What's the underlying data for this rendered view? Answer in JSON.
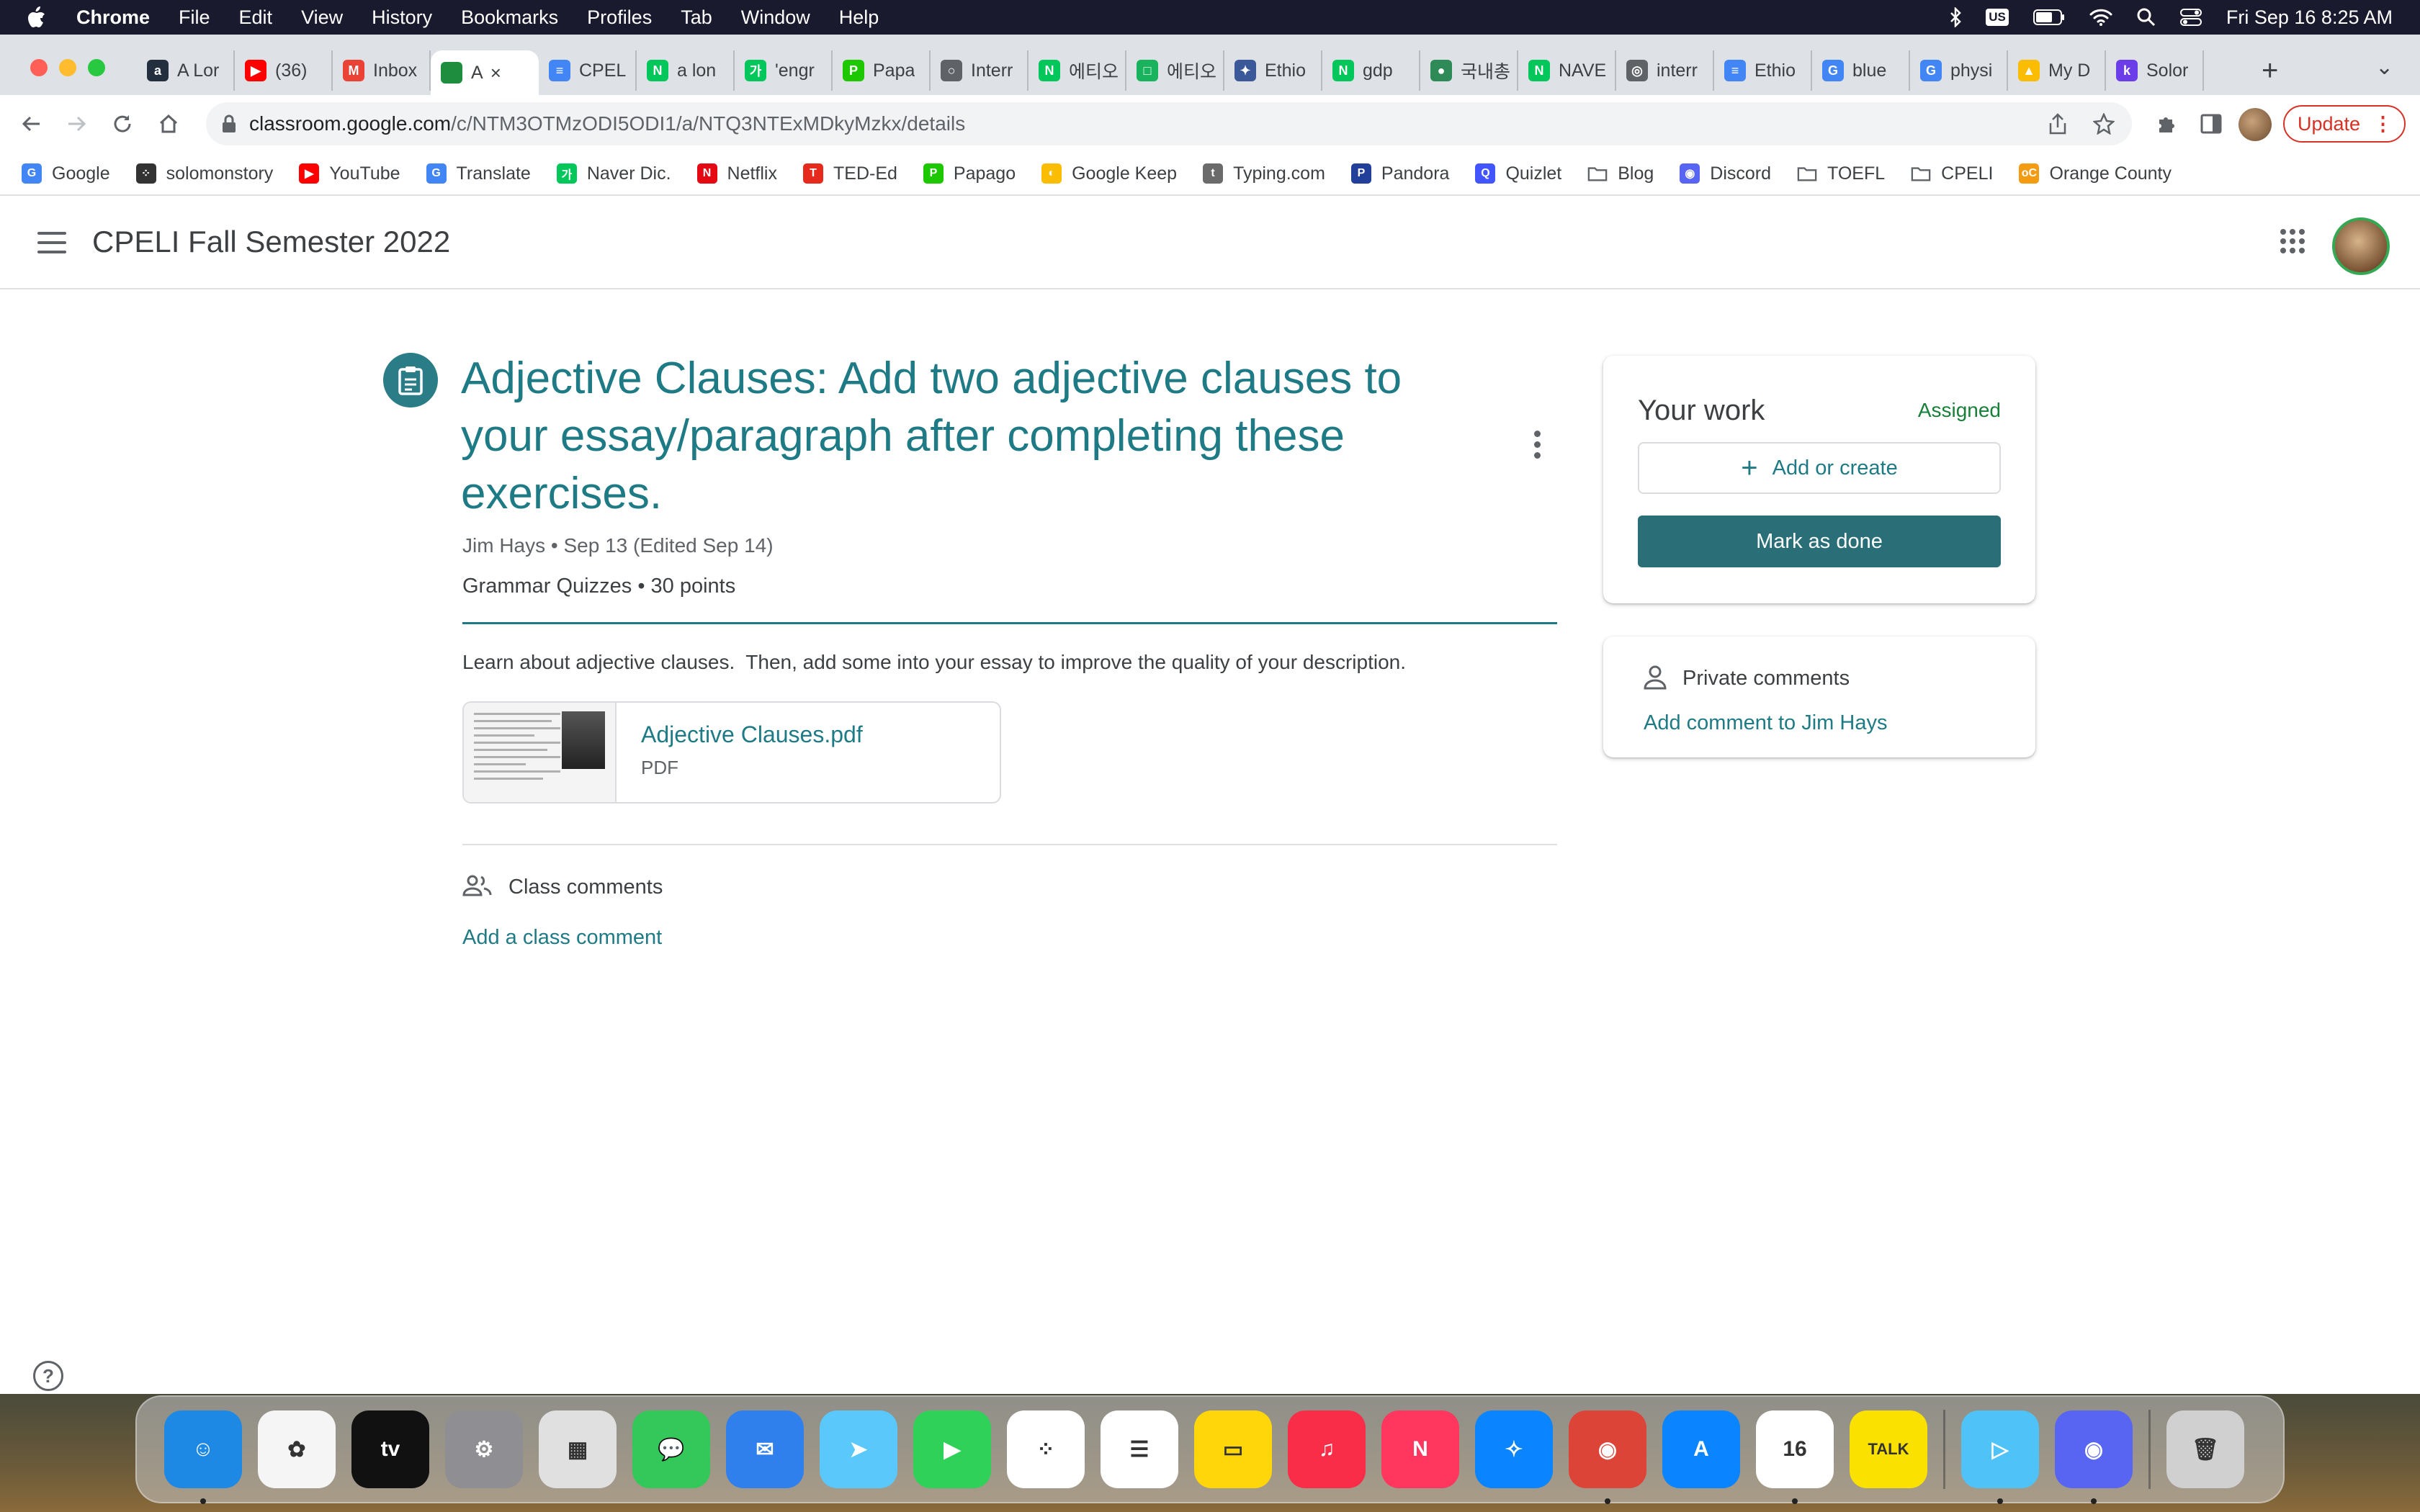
{
  "menubar": {
    "app_name": "Chrome",
    "items": [
      "File",
      "Edit",
      "View",
      "History",
      "Bookmarks",
      "Profiles",
      "Tab",
      "Window",
      "Help"
    ],
    "keyboard_badge": "US",
    "datetime": "Fri Sep 16  8:25 AM"
  },
  "tabs": [
    {
      "label": "A Lor",
      "icon": "amazon-icon",
      "color": "#232f3e",
      "glyph": "a"
    },
    {
      "label": "(36)",
      "icon": "youtube-icon",
      "color": "#ff0000",
      "glyph": "▶"
    },
    {
      "label": "Inbox",
      "icon": "gmail-icon",
      "color": "#ea4335",
      "glyph": "M"
    },
    {
      "label": "A",
      "icon": "classroom-icon",
      "color": "#1e8e3e",
      "glyph": "",
      "active": true
    },
    {
      "label": "CPEL",
      "icon": "docs-icon",
      "color": "#4285f4",
      "glyph": "≡"
    },
    {
      "label": "a lon",
      "icon": "naver-icon",
      "color": "#03c75a",
      "glyph": "N"
    },
    {
      "label": "'engr",
      "icon": "naver-dic-icon",
      "color": "#03c75a",
      "glyph": "가"
    },
    {
      "label": "Papa",
      "icon": "papago-icon",
      "color": "#1ec800",
      "glyph": "P"
    },
    {
      "label": "Interr",
      "icon": "loading-icon",
      "color": "#5f6368",
      "glyph": "○"
    },
    {
      "label": "에티오",
      "icon": "naver-icon",
      "color": "#03c75a",
      "glyph": "N"
    },
    {
      "label": "에티오",
      "icon": "green-square-icon",
      "color": "#19b35e",
      "glyph": "□"
    },
    {
      "label": "Ethio",
      "icon": "ethiopia-emblem-icon",
      "color": "#3b5998",
      "glyph": "✦"
    },
    {
      "label": "gdp",
      "icon": "naver-icon",
      "color": "#03c75a",
      "glyph": "N"
    },
    {
      "label": "국내총",
      "icon": "green-circle-icon",
      "color": "#2e8b57",
      "glyph": "●"
    },
    {
      "label": "NAVE",
      "icon": "naver-icon",
      "color": "#03c75a",
      "glyph": "N"
    },
    {
      "label": "interr",
      "icon": "globe-icon",
      "color": "#5f6368",
      "glyph": "◎"
    },
    {
      "label": "Ethio",
      "icon": "docs-icon",
      "color": "#4285f4",
      "glyph": "≡"
    },
    {
      "label": "blue",
      "icon": "google-icon",
      "color": "#4285f4",
      "glyph": "G"
    },
    {
      "label": "physi",
      "icon": "google-icon",
      "color": "#4285f4",
      "glyph": "G"
    },
    {
      "label": "My D",
      "icon": "drive-icon",
      "color": "#fbbc04",
      "glyph": "▲"
    },
    {
      "label": "Solor",
      "icon": "k-icon",
      "color": "#6a3de8",
      "glyph": "k"
    }
  ],
  "address_bar": {
    "host": "classroom.google.com",
    "path": "/c/NTM3OTMzODI5ODI1/a/NTQ3NTExMDkyMzkx/details"
  },
  "update_button": "Update",
  "bookmarks": [
    {
      "label": "Google",
      "icon": "google-icon",
      "color": "#4285f4",
      "glyph": "G"
    },
    {
      "label": "solomonstory",
      "icon": "dots-icon",
      "color": "#333333",
      "glyph": "⁘"
    },
    {
      "label": "YouTube",
      "icon": "youtube-icon",
      "color": "#ff0000",
      "glyph": "▶"
    },
    {
      "label": "Translate",
      "icon": "translate-icon",
      "color": "#4285f4",
      "glyph": "G"
    },
    {
      "label": "Naver Dic.",
      "icon": "naver-dic-icon",
      "color": "#03c75a",
      "glyph": "가"
    },
    {
      "label": "Netflix",
      "icon": "netflix-icon",
      "color": "#e50914",
      "glyph": "N"
    },
    {
      "label": "TED-Ed",
      "icon": "ted-icon",
      "color": "#e62b1e",
      "glyph": "T"
    },
    {
      "label": "Papago",
      "icon": "papago-icon",
      "color": "#1ec800",
      "glyph": "P"
    },
    {
      "label": "Google Keep",
      "icon": "keep-icon",
      "color": "#fbbc04",
      "glyph": "◐"
    },
    {
      "label": "Typing.com",
      "icon": "typing-icon",
      "color": "#6b6b6b",
      "glyph": "t"
    },
    {
      "label": "Pandora",
      "icon": "pandora-icon",
      "color": "#224099",
      "glyph": "P"
    },
    {
      "label": "Quizlet",
      "icon": "quizlet-icon",
      "color": "#4255ff",
      "glyph": "Q"
    },
    {
      "label": "Blog",
      "icon": "folder-icon",
      "color": "#8a8d91",
      "glyph": ""
    },
    {
      "label": "Discord",
      "icon": "discord-icon",
      "color": "#5865f2",
      "glyph": "◉"
    },
    {
      "label": "TOEFL",
      "icon": "folder-icon",
      "color": "#8a8d91",
      "glyph": ""
    },
    {
      "label": "CPELI",
      "icon": "folder-icon",
      "color": "#8a8d91",
      "glyph": ""
    },
    {
      "label": "Orange County",
      "icon": "oc-icon",
      "color": "#f39c12",
      "glyph": "oC"
    }
  ],
  "classroom": {
    "class_name": "CPELI Fall Semester 2022",
    "assignment": {
      "title": "Adjective Clauses: Add two adjective clauses to your essay/paragraph after completing these exercises.",
      "meta": "Jim Hays • Sep 13 (Edited Sep 14)",
      "topic_points": "Grammar Quizzes • 30 points",
      "instructions": "Learn about adjective clauses.  Then, add some into your essay to improve the quality of your description.",
      "attachment": {
        "name": "Adjective Clauses.pdf",
        "type": "PDF"
      }
    },
    "class_comments": {
      "label": "Class comments",
      "add_link": "Add a class comment"
    },
    "your_work": {
      "title": "Your work",
      "status": "Assigned",
      "add_button": "Add or create",
      "done_button": "Mark as done"
    },
    "private_comments": {
      "title": "Private comments",
      "add_link": "Add comment to Jim Hays"
    },
    "colors": {
      "accent": "#1e7b85",
      "button": "#2a6f77",
      "status": "#188038"
    }
  },
  "dock": [
    {
      "name": "finder",
      "color": "#1e88e5",
      "glyph": "☺",
      "running": true
    },
    {
      "name": "photos",
      "color": "#f5f5f5",
      "glyph": "✿"
    },
    {
      "name": "apple-tv",
      "color": "#111111",
      "glyph": "tv"
    },
    {
      "name": "system-preferences",
      "color": "#8e8e93",
      "glyph": "⚙"
    },
    {
      "name": "launchpad",
      "color": "#e0e0e0",
      "glyph": "▦"
    },
    {
      "name": "messages",
      "color": "#34c759",
      "glyph": "💬"
    },
    {
      "name": "mail",
      "color": "#2f80ed",
      "glyph": "✉"
    },
    {
      "name": "maps",
      "color": "#5ac8fa",
      "glyph": "➤"
    },
    {
      "name": "facetime",
      "color": "#30d158",
      "glyph": "▶"
    },
    {
      "name": "dots-app",
      "color": "#ffffff",
      "glyph": "⁘"
    },
    {
      "name": "reminders",
      "color": "#ffffff",
      "glyph": "☰"
    },
    {
      "name": "notes",
      "color": "#ffd60a",
      "glyph": "▭"
    },
    {
      "name": "music",
      "color": "#fa2d48",
      "glyph": "♫"
    },
    {
      "name": "news",
      "color": "#ff375f",
      "glyph": "N"
    },
    {
      "name": "safari",
      "color": "#0a84ff",
      "glyph": "✧"
    },
    {
      "name": "chrome",
      "color": "#db4437",
      "glyph": "◉",
      "running": true
    },
    {
      "name": "app-store",
      "color": "#0a84ff",
      "glyph": "A"
    },
    {
      "name": "calendar",
      "color": "#ffffff",
      "glyph": "16",
      "running": true
    },
    {
      "name": "kakaotalk",
      "color": "#fae100",
      "glyph": "TALK"
    },
    {
      "name": "prime-video",
      "color": "#4fc3f7",
      "glyph": "▷",
      "running": true
    },
    {
      "name": "discord",
      "color": "#5865f2",
      "glyph": "◉",
      "running": true
    },
    {
      "name": "trash",
      "color": "#d0d0d0",
      "glyph": "🗑"
    }
  ]
}
